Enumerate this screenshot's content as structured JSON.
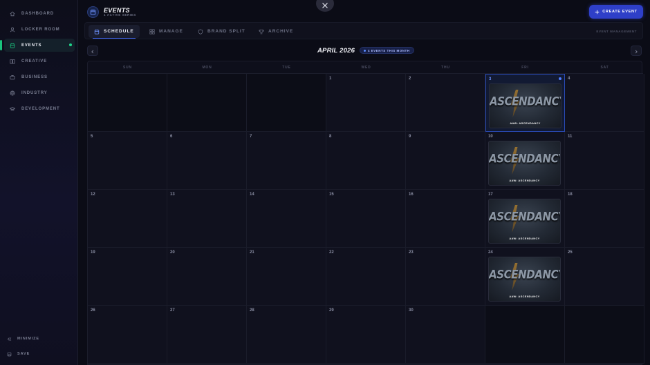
{
  "sidebar": {
    "items": [
      {
        "label": "DASHBOARD",
        "icon": "home-icon"
      },
      {
        "label": "LOCKER ROOM",
        "icon": "user-icon"
      },
      {
        "label": "EVENTS",
        "icon": "calendar-icon",
        "active": true
      },
      {
        "label": "CREATIVE",
        "icon": "book-icon"
      },
      {
        "label": "BUSINESS",
        "icon": "briefcase-icon"
      },
      {
        "label": "INDUSTRY",
        "icon": "globe-icon"
      },
      {
        "label": "DEVELOPMENT",
        "icon": "graduation-icon"
      }
    ],
    "minimize_label": "MINIMIZE",
    "save_label": "SAVE"
  },
  "header": {
    "title": "EVENTS",
    "subtitle": "1 ACTIVE SERIES",
    "create_label": "CREATE EVENT"
  },
  "tabs": [
    {
      "label": "SCHEDULE",
      "icon": "calendar-icon",
      "active": true
    },
    {
      "label": "MANAGE",
      "icon": "grid-icon"
    },
    {
      "label": "BRAND SPLIT",
      "icon": "shield-icon"
    },
    {
      "label": "ARCHIVE",
      "icon": "trophy-icon"
    }
  ],
  "tab_right_label": "EVENT MANAGEMENT",
  "calendar": {
    "month_title": "APRIL 2026",
    "event_count_label": "4 EVENTS THIS MONTH",
    "weekdays": [
      "SUN",
      "MON",
      "TUE",
      "WED",
      "THU",
      "FRI",
      "SAT"
    ],
    "rows": [
      [
        "",
        "",
        "",
        "1",
        "2",
        "3",
        "4"
      ],
      [
        "5",
        "6",
        "7",
        "8",
        "9",
        "10",
        "11"
      ],
      [
        "12",
        "13",
        "14",
        "15",
        "16",
        "17",
        "18"
      ],
      [
        "19",
        "20",
        "21",
        "22",
        "23",
        "24",
        "25"
      ],
      [
        "26",
        "27",
        "28",
        "29",
        "30",
        "",
        ""
      ]
    ],
    "today": "3",
    "events": [
      {
        "day": "3",
        "brand": "ASCENDANCY",
        "tag": "AAW: ASCENDANCY"
      },
      {
        "day": "10",
        "brand": "ASCENDANCY",
        "tag": "AAW: ASCENDANCY"
      },
      {
        "day": "17",
        "brand": "ASCENDANCY",
        "tag": "AAW: ASCENDANCY"
      },
      {
        "day": "24",
        "brand": "ASCENDANCY",
        "tag": "AAW: ASCENDANCY"
      }
    ]
  },
  "colors": {
    "accent": "#2e3fc8",
    "active_indicator": "#19c37d",
    "today_border": "#2a4bb8"
  }
}
